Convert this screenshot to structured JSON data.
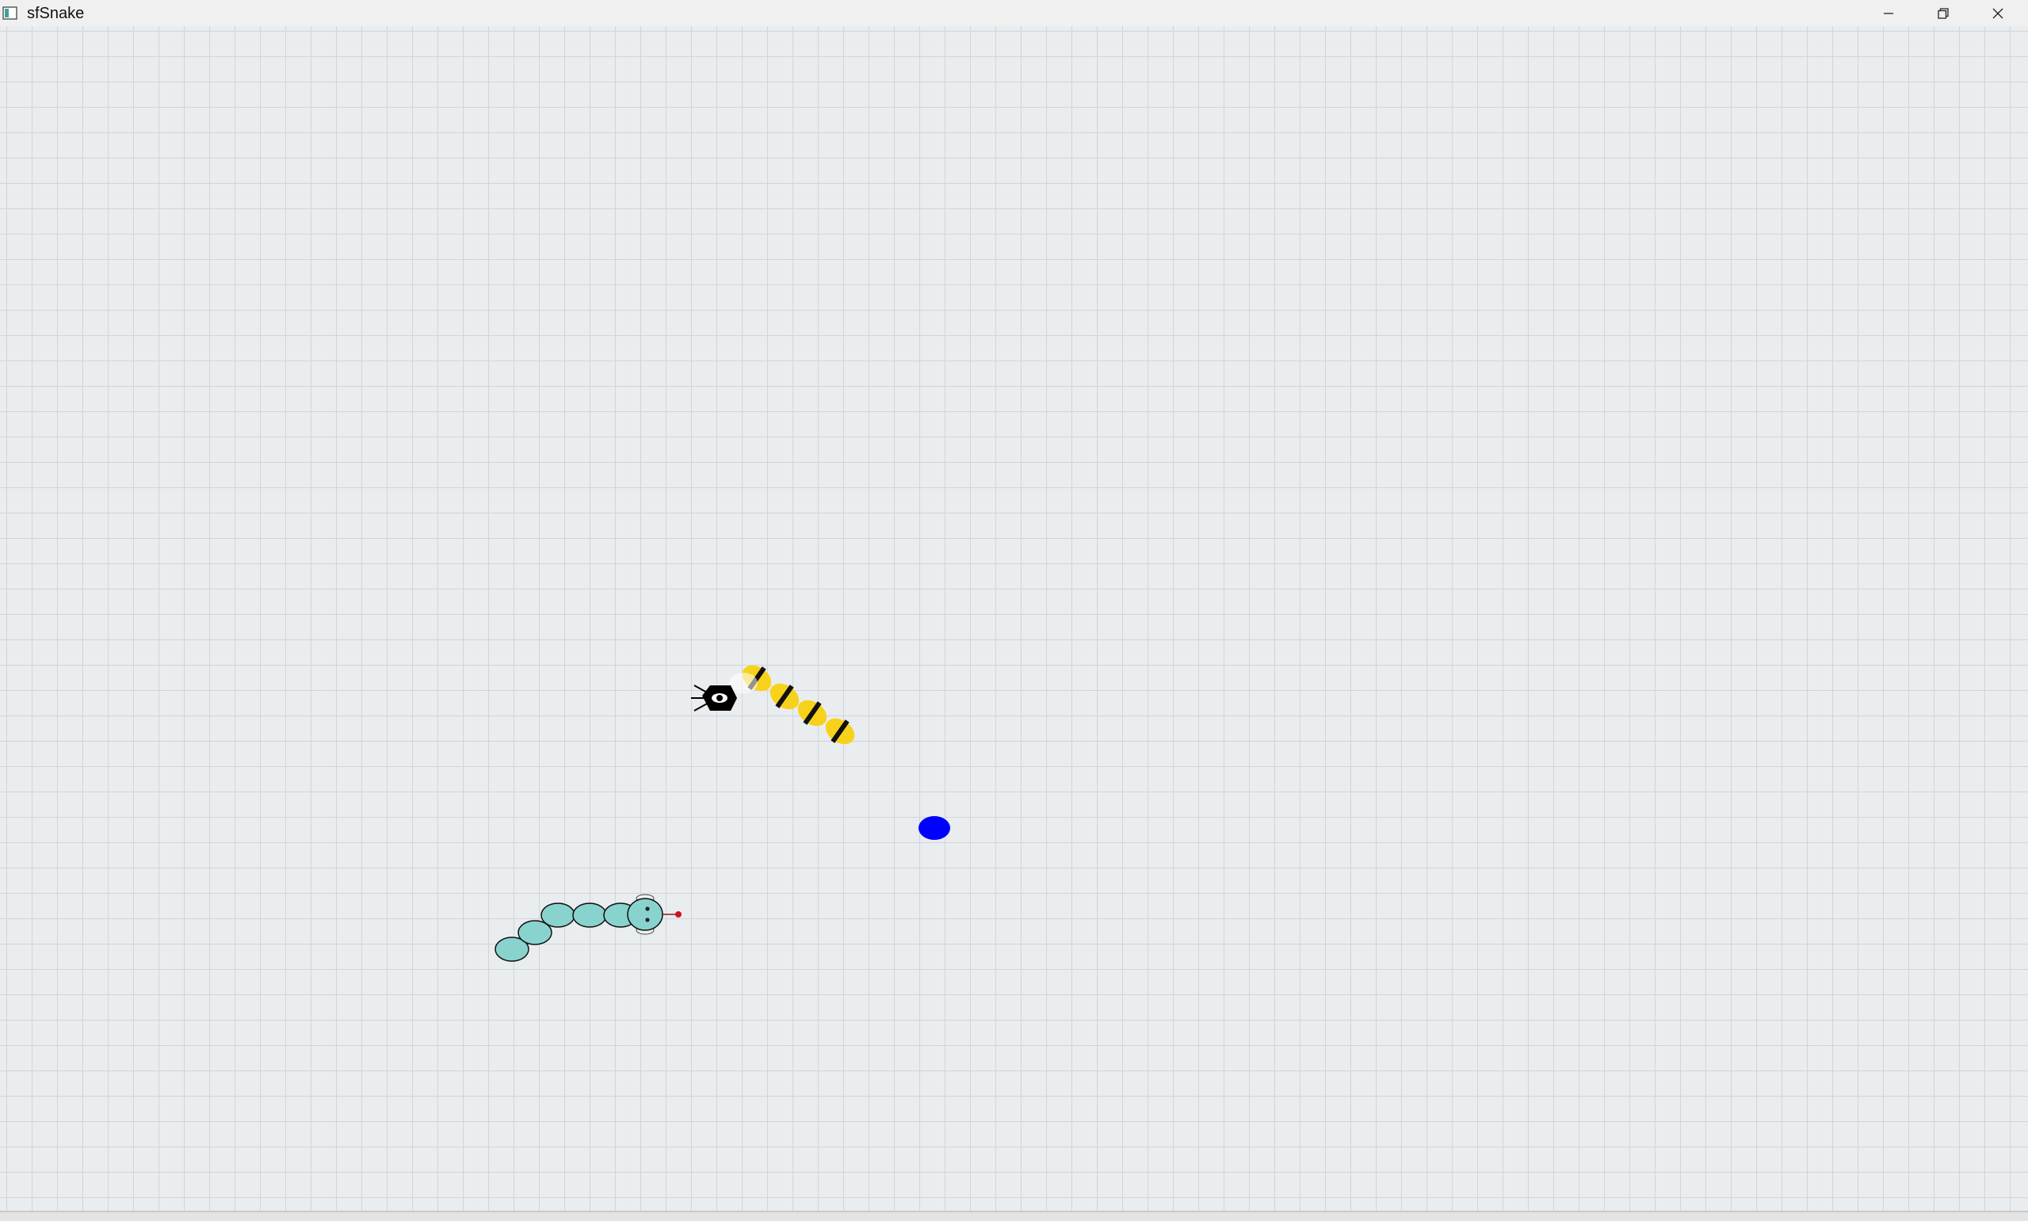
{
  "window": {
    "title": "sfSnake",
    "icon": "app-icon",
    "controls": {
      "minimize": "minimize-icon",
      "maximize": "restore-icon",
      "close": "close-icon"
    }
  },
  "game": {
    "background_color": "#eaedef",
    "grid_color": "#d2d5d8",
    "bee_snake": {
      "head_color": "#000000",
      "body_color": "#f7d21b",
      "stripe_color": "#111111",
      "segments": 4
    },
    "player_snake": {
      "body_color": "#88d3ce",
      "tongue_color": "#d0141a",
      "segments": 6
    },
    "fruit": {
      "color": "#0000ff"
    }
  }
}
